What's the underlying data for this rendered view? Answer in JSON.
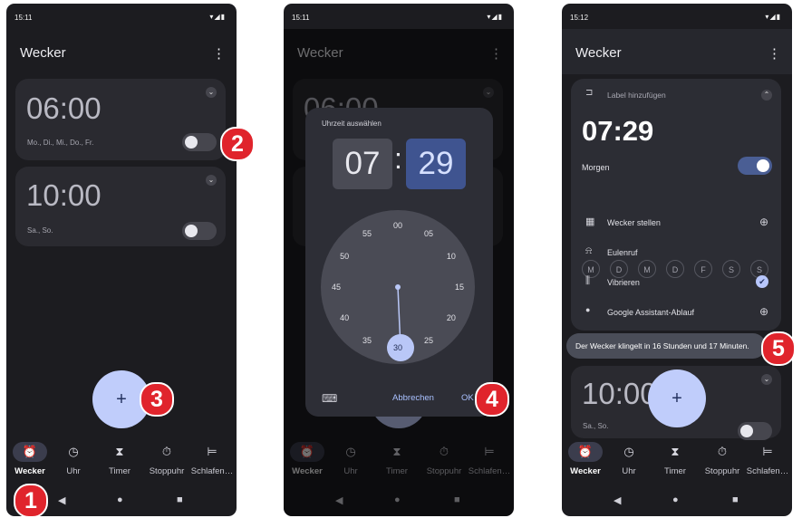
{
  "status": {
    "time_1": "15:11",
    "time_2": "15:11",
    "time_3": "15:12",
    "icons": "▾◢▮"
  },
  "app": {
    "title": "Wecker",
    "menu": "⋮"
  },
  "alarms": [
    {
      "time": "06:00",
      "days": "Mo., Di., Mi., Do., Fr.",
      "enabled": false
    },
    {
      "time": "10:00",
      "days": "Sa., So.",
      "enabled": false
    }
  ],
  "fab": {
    "label": "+"
  },
  "nav": {
    "items": [
      {
        "label": "Wecker",
        "icon": "alarm-icon",
        "glyph": "⏰"
      },
      {
        "label": "Uhr",
        "icon": "clock-icon",
        "glyph": "◷"
      },
      {
        "label": "Timer",
        "icon": "hourglass-icon",
        "glyph": "⧗"
      },
      {
        "label": "Stoppuhr",
        "icon": "stopwatch-icon",
        "glyph": "⏱"
      },
      {
        "label": "Schlafen…",
        "icon": "bed-icon",
        "glyph": "⊨"
      }
    ]
  },
  "sysnav": {
    "back": "◀",
    "home": "●",
    "recents": "■"
  },
  "picker": {
    "title": "Uhrzeit auswählen",
    "hour": "07",
    "separator": ":",
    "minute": "29",
    "numbers": [
      "00",
      "05",
      "10",
      "15",
      "20",
      "25",
      "30",
      "35",
      "40",
      "45",
      "50",
      "55"
    ],
    "keyboard_icon": "⌨",
    "cancel": "Abbrechen",
    "ok": "OK"
  },
  "expanded": {
    "label_placeholder": "Label hinzufügen",
    "time": "07:29",
    "morning": "Morgen",
    "enabled": true,
    "days": [
      "M",
      "D",
      "M",
      "D",
      "F",
      "S",
      "S"
    ],
    "rows": [
      {
        "label": "Wecker stellen",
        "icon": "calendar-icon",
        "glyph": "▦",
        "end": "⊕"
      },
      {
        "label": "Eulenruf",
        "icon": "bell-icon",
        "glyph": "⍾",
        "end": ""
      },
      {
        "label": "Vibrieren",
        "icon": "vibrate-icon",
        "glyph": "⫼",
        "end": "✔"
      },
      {
        "label": "Google Assistant-Ablauf",
        "icon": "assistant-icon",
        "glyph": "●",
        "end": "⊕"
      }
    ],
    "toast": "Der Wecker klingelt in 16 Stunden und 17 Minuten."
  },
  "badges": [
    "1",
    "2",
    "3",
    "4",
    "5"
  ],
  "colors": {
    "accent": "#c0cdfb",
    "badge": "#e0242c",
    "minute_box": "#3f5490"
  }
}
